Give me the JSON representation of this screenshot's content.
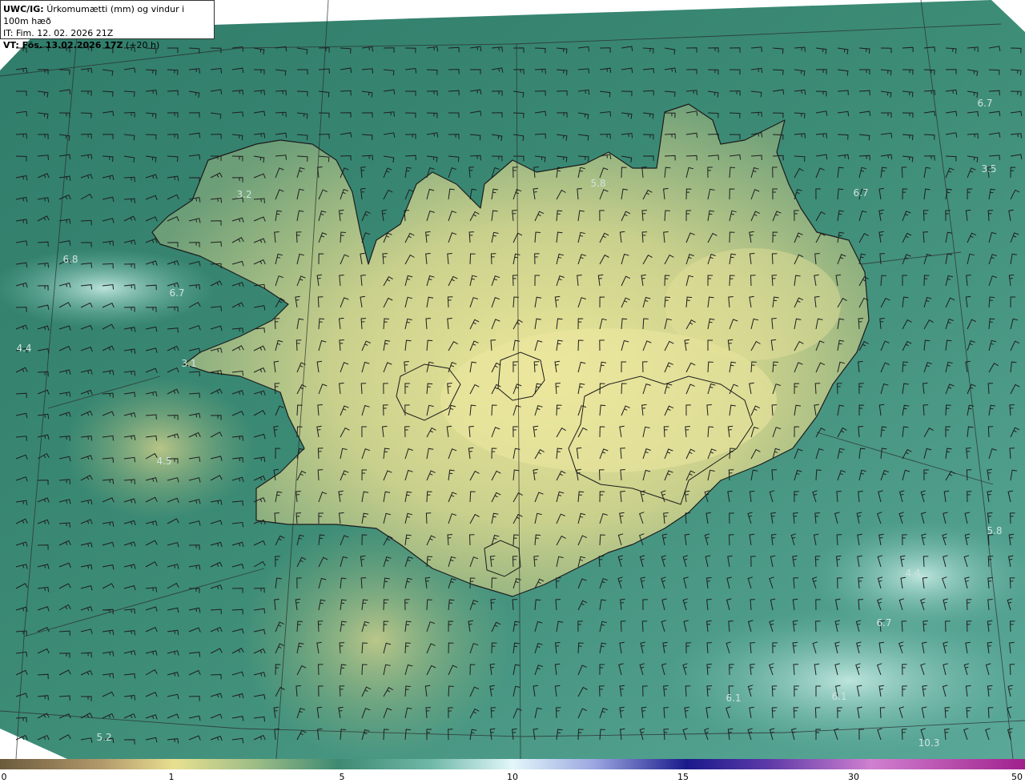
{
  "header": {
    "model": "UWC/IG:",
    "product": "Úrkomumætti (mm) og vindur i 100m hæð",
    "init_time": "IT: Fim. 12. 02. 2026 21Z",
    "valid_prefix": "VT: Fös. 13.02.2026 17Z",
    "valid_suffix": "(+20 h)"
  },
  "value_labels": [
    "6.7",
    "3.5",
    "6.7",
    "5.8",
    "3.2",
    "6.8",
    "6.7",
    "4.4",
    "3.1",
    "4.5",
    "5.8",
    "4.4",
    "6.7",
    "6.1",
    "6.1",
    "5.2",
    "10.3"
  ],
  "colorbar": {
    "ticks": [
      "0",
      "1",
      "5",
      "10",
      "15",
      "30",
      "50"
    ],
    "colors": [
      "#6b5a3c",
      "#b39a6c",
      "#e8e090",
      "#9cbc86",
      "#3e8a72",
      "#6fb8a8",
      "#e2f7fa",
      "#9aa6e0",
      "#1a1a8c",
      "#5e3aa8",
      "#d080d0",
      "#a0208c"
    ]
  },
  "palette": {
    "sea": "#3c8874",
    "lowland": "#7aa878",
    "highland": "#e8e498",
    "coast_line": "#1c1c1c"
  }
}
